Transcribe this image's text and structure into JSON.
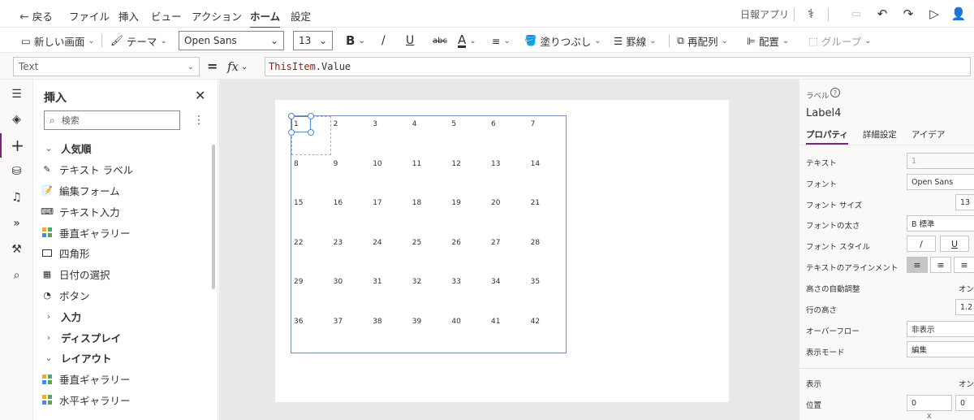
{
  "menu": {
    "back": "戻る",
    "items": [
      "ファイル",
      "挿入",
      "ビュー",
      "アクション",
      "ホーム",
      "設定"
    ],
    "active_index": 4,
    "app_name": "日報アプリ"
  },
  "toolbar": {
    "new_screen": "新しい画面",
    "theme": "テーマ",
    "font": "Open Sans",
    "font_size": "13",
    "bold": "B",
    "italic": "/",
    "underline": "U",
    "strike": "abc",
    "font_color": "A",
    "fill": "塗りつぶし",
    "border": "罫線",
    "reorder": "再配列",
    "align": "配置",
    "group": "グループ"
  },
  "formula": {
    "property": "Text",
    "eq": "=",
    "fx": "fx",
    "part1": "ThisItem",
    "part2": ".Value"
  },
  "insert_panel": {
    "title": "挿入",
    "search_placeholder": "検索",
    "rows": [
      {
        "type": "cat",
        "label": "人気順",
        "icon": "chevron-down-icon"
      },
      {
        "type": "item",
        "label": "テキスト ラベル",
        "icon": "text-label-icon"
      },
      {
        "type": "item",
        "label": "編集フォーム",
        "icon": "edit-form-icon"
      },
      {
        "type": "item",
        "label": "テキスト入力",
        "icon": "text-input-icon"
      },
      {
        "type": "item",
        "label": "垂直ギャラリー",
        "icon": "gallery-icon"
      },
      {
        "type": "item",
        "label": "四角形",
        "icon": "rectangle-icon"
      },
      {
        "type": "item",
        "label": "日付の選択",
        "icon": "calendar-icon"
      },
      {
        "type": "item",
        "label": "ボタン",
        "icon": "button-icon"
      },
      {
        "type": "cat",
        "label": "入力",
        "icon": "chevron-right-icon"
      },
      {
        "type": "cat",
        "label": "ディスプレイ",
        "icon": "chevron-right-icon"
      },
      {
        "type": "cat",
        "label": "レイアウト",
        "icon": "chevron-down-icon"
      },
      {
        "type": "item",
        "label": "垂直ギャラリー",
        "icon": "gallery-icon"
      },
      {
        "type": "item",
        "label": "水平ギャラリー",
        "icon": "gallery-icon"
      }
    ]
  },
  "gallery": {
    "cells": [
      "1",
      "2",
      "3",
      "4",
      "5",
      "6",
      "7",
      "8",
      "9",
      "10",
      "11",
      "12",
      "13",
      "14",
      "15",
      "16",
      "17",
      "18",
      "19",
      "20",
      "21",
      "22",
      "23",
      "24",
      "25",
      "26",
      "27",
      "28",
      "29",
      "30",
      "31",
      "32",
      "33",
      "34",
      "35",
      "36",
      "37",
      "38",
      "39",
      "40",
      "41",
      "42"
    ]
  },
  "props": {
    "type_label": "ラベル",
    "control_name": "Label4",
    "tabs": [
      "プロパティ",
      "詳細設定",
      "アイデア"
    ],
    "text_label": "テキスト",
    "text_value": "1",
    "font_label": "フォント",
    "font_value": "Open Sans",
    "font_size_label": "フォント サイズ",
    "font_size_value": "13",
    "font_weight_label": "フォントの太さ",
    "font_weight_value": "B  標準",
    "font_style_label": "フォント スタイル",
    "italic": "/",
    "underline": "U",
    "align_label": "テキストのアラインメント",
    "autoheight_label": "高さの自動調整",
    "autoheight_value": "オン",
    "line_height_label": "行の高さ",
    "line_height_value": "1.2",
    "overflow_label": "オーバーフロー",
    "overflow_value": "非表示",
    "display_mode_label": "表示モード",
    "display_mode_value": "編集",
    "visible_label": "表示",
    "visible_value": "オン",
    "position_label": "位置",
    "pos_x": "0",
    "pos_y": "0",
    "x_label": "X"
  }
}
